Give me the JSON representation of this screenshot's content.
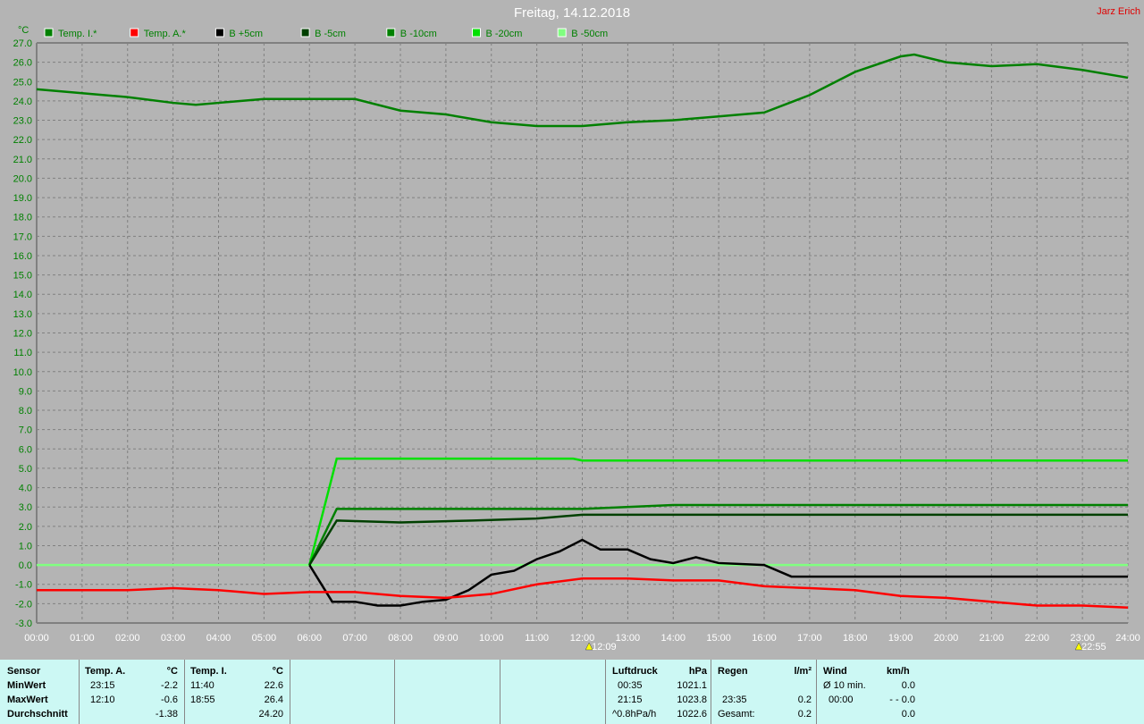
{
  "title": "Freitag, 14.12.2018",
  "author": "Jarz Erich",
  "chart_data": {
    "type": "line",
    "unit": "°C",
    "ylim": [
      -3,
      27
    ],
    "xlim": [
      0,
      24
    ],
    "grid": true,
    "legend_position": "top",
    "y_ticks": [
      "27.0",
      "26.0",
      "25.0",
      "24.0",
      "23.0",
      "22.0",
      "21.0",
      "20.0",
      "19.0",
      "18.0",
      "17.0",
      "16.0",
      "15.0",
      "14.0",
      "13.0",
      "12.0",
      "11.0",
      "10.0",
      "9.0",
      "8.0",
      "7.0",
      "6.0",
      "5.0",
      "4.0",
      "3.0",
      "2.0",
      "1.0",
      "0.0",
      "-1.0",
      "-2.0",
      "-3.0"
    ],
    "x_ticks": [
      "00:00",
      "01:00",
      "02:00",
      "03:00",
      "04:00",
      "05:00",
      "06:00",
      "07:00",
      "08:00",
      "09:00",
      "10:00",
      "11:00",
      "12:00",
      "13:00",
      "14:00",
      "15:00",
      "16:00",
      "17:00",
      "18:00",
      "19:00",
      "20:00",
      "21:00",
      "22:00",
      "23:00",
      "24:00"
    ],
    "annotations": [
      {
        "label": "12:09",
        "x": 12.15,
        "kind": "sunrise"
      },
      {
        "label": "22:55",
        "x": 22.92,
        "kind": "sunset"
      }
    ],
    "series": [
      {
        "name": "Temp. I.*",
        "color": "#008000",
        "x": [
          0,
          1,
          2,
          3,
          3.5,
          4,
          5,
          6,
          7,
          8,
          9,
          10,
          11,
          12,
          13,
          14,
          15,
          16,
          17,
          18,
          19,
          19.3,
          20,
          21,
          22,
          23,
          24
        ],
        "y": [
          24.6,
          24.4,
          24.2,
          23.9,
          23.8,
          23.9,
          24.1,
          24.1,
          24.1,
          23.5,
          23.3,
          22.9,
          22.7,
          22.7,
          22.9,
          23.0,
          23.2,
          23.4,
          24.3,
          25.5,
          26.3,
          26.4,
          26.0,
          25.8,
          25.9,
          25.6,
          25.2
        ]
      },
      {
        "name": "Temp. A.*",
        "color": "#ff0000",
        "x": [
          0,
          1,
          2,
          3,
          4,
          5,
          6,
          7,
          8,
          9,
          10,
          11,
          12,
          13,
          14,
          15,
          16,
          17,
          18,
          19,
          20,
          21,
          22,
          23,
          24
        ],
        "y": [
          -1.3,
          -1.3,
          -1.3,
          -1.2,
          -1.3,
          -1.5,
          -1.4,
          -1.4,
          -1.6,
          -1.7,
          -1.5,
          -1.0,
          -0.7,
          -0.7,
          -0.8,
          -0.8,
          -1.1,
          -1.2,
          -1.3,
          -1.6,
          -1.7,
          -1.9,
          -2.1,
          -2.1,
          -2.2
        ]
      },
      {
        "name": "B +5cm",
        "color": "#000000",
        "x": [
          6,
          6.5,
          7,
          7.5,
          8,
          8.5,
          9,
          9.5,
          10,
          10.5,
          11,
          11.5,
          12,
          12.4,
          13,
          13.5,
          14,
          14.5,
          15,
          16,
          16.6,
          24
        ],
        "y": [
          0,
          -1.9,
          -1.9,
          -2.1,
          -2.1,
          -1.9,
          -1.8,
          -1.3,
          -0.5,
          -0.3,
          0.3,
          0.7,
          1.3,
          0.8,
          0.8,
          0.3,
          0.1,
          0.4,
          0.1,
          0.0,
          -0.6,
          -0.6
        ]
      },
      {
        "name": "B -5cm",
        "color": "#004000",
        "x": [
          6,
          6.6,
          8,
          9.6,
          11,
          12,
          24
        ],
        "y": [
          0,
          2.3,
          2.2,
          2.3,
          2.4,
          2.6,
          2.6
        ]
      },
      {
        "name": "B -10cm",
        "color": "#008000",
        "x": [
          6,
          6.6,
          12,
          14,
          24
        ],
        "y": [
          0,
          2.9,
          2.9,
          3.1,
          3.1
        ]
      },
      {
        "name": "B -20cm",
        "color": "#00e000",
        "x": [
          6,
          6.6,
          11.8,
          12,
          24
        ],
        "y": [
          0,
          5.5,
          5.5,
          5.4,
          5.4
        ]
      },
      {
        "name": "B -50cm",
        "color": "#80ff80",
        "x": [
          0,
          24
        ],
        "y": [
          0,
          0
        ]
      }
    ]
  },
  "table": {
    "sensor": {
      "h": "Sensor",
      "min": "MinWert",
      "max": "MaxWert",
      "avg": "Durchschnitt"
    },
    "temp_a": {
      "h": "Temp. A.",
      "u": "°C",
      "min_t": "23:15",
      "min_v": "-2.2",
      "max_t": "12:10",
      "max_v": "-0.6",
      "avg": "-1.38"
    },
    "temp_i": {
      "h": "Temp. I.",
      "u": "°C",
      "min_t": "11:40",
      "min_v": "22.6",
      "max_t": "18:55",
      "max_v": "26.4",
      "avg": "24.20"
    },
    "pressure": {
      "h": "Luftdruck",
      "u": "hPa",
      "min_t": "00:35",
      "min_v": "1021.1",
      "max_t": "21:15",
      "max_v": "1023.8",
      "trend": "^0.8hPa/h",
      "cur": "1022.6"
    },
    "rain": {
      "h": "Regen",
      "u": "l/m²",
      "max_t": "23:35",
      "max_v": "0.2",
      "total_l": "Gesamt:",
      "total_v": "0.2"
    },
    "wind": {
      "h": "Wind",
      "u": "km/h",
      "avg_l": "Ø 10 min.",
      "avg_v": "0.0",
      "max_t": "00:00",
      "max_v": "- - 0.0",
      "cur": "0.0"
    }
  }
}
